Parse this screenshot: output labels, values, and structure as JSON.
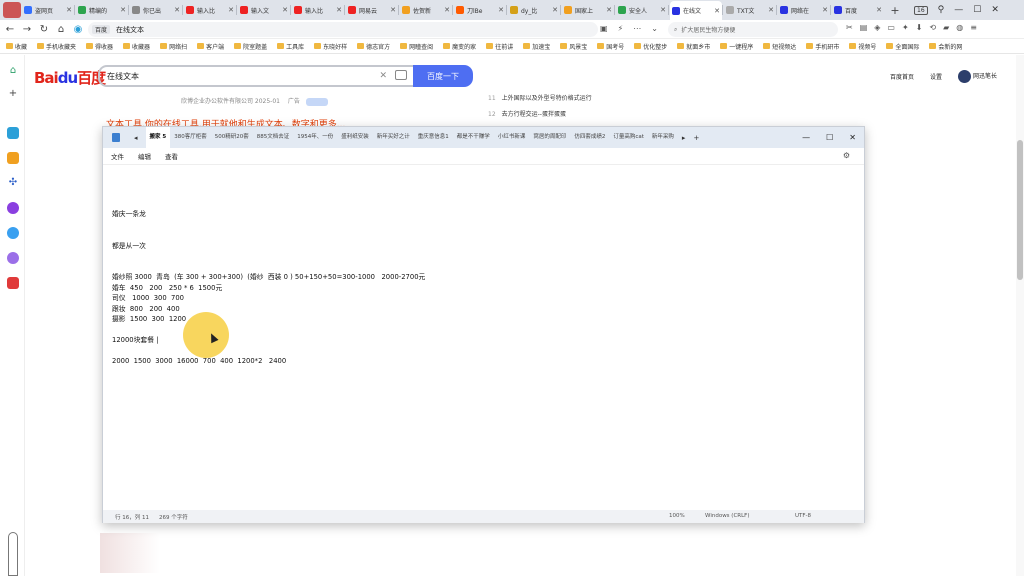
{
  "browser": {
    "tabs": [
      {
        "label": "盗网页",
        "color": "#3370ff"
      },
      {
        "label": "精编的",
        "color": "#2da44e"
      },
      {
        "label": "你已出",
        "color": "#888888"
      },
      {
        "label": "输入比",
        "color": "#e22"
      },
      {
        "label": "输入文",
        "color": "#e22"
      },
      {
        "label": "输入比",
        "color": "#e22"
      },
      {
        "label": "网易云",
        "color": "#e22"
      },
      {
        "label": "佐贺新",
        "color": "#f1a020"
      },
      {
        "label": "刀lBe",
        "color": "#ff5a00"
      },
      {
        "label": "dy_比",
        "color": "#d4a017"
      },
      {
        "label": "国家上",
        "color": "#f1a020"
      },
      {
        "label": "安全人",
        "color": "#2da44e"
      },
      {
        "label": "在线文",
        "color": "#2932e1",
        "active": true
      },
      {
        "label": "TXT文",
        "color": "#aaaaaa"
      },
      {
        "label": "网络在",
        "color": "#2932e1"
      },
      {
        "label": "百度",
        "color": "#2932e1"
      }
    ],
    "tab_counter": "16",
    "address": {
      "site_label": "百度",
      "text": "在线文本"
    },
    "search_placeholder": "扩大居民生物方便便",
    "bookmarks": [
      "收藏",
      "手机收藏夹",
      "得收器",
      "收藏器",
      "网络扫",
      "客户端",
      "院室题盖",
      "工具库",
      "东晓好样",
      "德志官方",
      "网瞳查阅",
      "魔变的家",
      "往前讲",
      "加速宝",
      "风景宝",
      "国考号",
      "优化整步",
      "就面乡市",
      "一键程序",
      "短视频达",
      "手机研市",
      "视频号",
      "全面国际",
      "会新的网"
    ]
  },
  "baidu": {
    "logo_left": "Bai",
    "logo_paw": "du",
    "logo_right": "百度",
    "search_value": "在线文本",
    "search_button": "百度一下",
    "nav": {
      "home": "百度首页",
      "settings": "设置",
      "user": "网迅笔长"
    },
    "meta": "欣博企业办公软件有限公司 2025-01",
    "ad": "广告",
    "result_title": "文本工具,你的在线工具,用于就他和生成文本、数字和更多...",
    "hot": [
      {
        "num": "11",
        "text": "上外国际以及外型号特价格式运行"
      },
      {
        "num": "12",
        "text": "去方行程交运--蛋拌蛋蛋"
      }
    ]
  },
  "notepad": {
    "tabs": [
      "搬家 5",
      "380客厅柜套",
      "500精研20套",
      "885文档去证",
      "1954年、一份",
      "盛利纸安装",
      "新年买好之计",
      "重庆意信息1",
      "都是不干赚学",
      "小红书新课",
      "窝居的周配印",
      "仿四套成绩2",
      "订量高购cat",
      "新年采购"
    ],
    "menu": [
      "文件",
      "编辑",
      "查看"
    ],
    "lines": [
      {
        "text": "婚庆一条龙",
        "row": 4
      },
      {
        "text": "都是从一次",
        "row": 7
      },
      {
        "text": "婚纱照 3000  青岛  (车 300 + 300+300)  (婚纱  西装 0 ) 50+150+50=300-1000   2000-2700元",
        "row": 10
      },
      {
        "text": "婚车  450   200   250 * 6  1500元",
        "row": 11
      },
      {
        "text": "司仪   1000  300  700",
        "row": 12
      },
      {
        "text": "跟妆  800   200  400",
        "row": 13
      },
      {
        "text": "摄影  1500  300  1200",
        "row": 14
      },
      {
        "text": "12000块套餐 |",
        "row": 16
      },
      {
        "text": "2000  1500  3000  16000  700  400  1200*2   2400",
        "row": 18
      }
    ],
    "status": {
      "position": "行 16，列 11",
      "chars": "269 个字符",
      "zoom": "100%",
      "eol": "Windows (CRLF)",
      "encoding": "UTF-8"
    }
  }
}
